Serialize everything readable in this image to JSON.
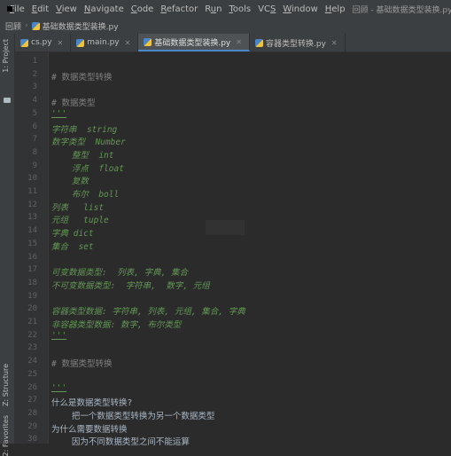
{
  "menubar": {
    "items": [
      {
        "label": "File",
        "ul": "F"
      },
      {
        "label": "Edit",
        "ul": "E"
      },
      {
        "label": "View",
        "ul": "V"
      },
      {
        "label": "Navigate",
        "ul": "N"
      },
      {
        "label": "Code",
        "ul": "C"
      },
      {
        "label": "Refactor",
        "ul": "R"
      },
      {
        "label": "Run",
        "ul": "u"
      },
      {
        "label": "Tools",
        "ul": "T"
      },
      {
        "label": "VCS",
        "ul": "S"
      },
      {
        "label": "Window",
        "ul": "W"
      },
      {
        "label": "Help",
        "ul": "H"
      }
    ],
    "window_title": "回顾 - 基础数据类型装换.py"
  },
  "navbar": {
    "project": "回顾",
    "file": "基础数据类型装换.py"
  },
  "sidebar": {
    "project_label": "1: Project",
    "structure_label": "Z: Structure",
    "favorites_label": "2: Favorites"
  },
  "tabs": [
    {
      "label": "cs.py",
      "active": false
    },
    {
      "label": "main.py",
      "active": false
    },
    {
      "label": "基础数据类型装换.py",
      "active": true
    },
    {
      "label": "容器类型转换.py",
      "active": false
    }
  ],
  "code_lines": [
    {
      "n": "1",
      "text": "",
      "style": "plain"
    },
    {
      "n": "2",
      "text": "# 数据类型转换",
      "style": "comment"
    },
    {
      "n": "3",
      "text": "",
      "style": "plain"
    },
    {
      "n": "4",
      "text": "# 数据类型",
      "style": "comment"
    },
    {
      "n": "5",
      "text": "'''",
      "style": "quote"
    },
    {
      "n": "6",
      "text": "字符串  string",
      "style": "doc"
    },
    {
      "n": "7",
      "text": "数字类型  Number",
      "style": "doc"
    },
    {
      "n": "8",
      "text": "    整型  int",
      "style": "doc"
    },
    {
      "n": "9",
      "text": "    浮点  float",
      "style": "doc"
    },
    {
      "n": "10",
      "text": "    复数",
      "style": "doc"
    },
    {
      "n": "11",
      "text": "    布尔  boll",
      "style": "doc"
    },
    {
      "n": "12",
      "text": "列表   list",
      "style": "doc"
    },
    {
      "n": "13",
      "text": "元组   tuple",
      "style": "doc"
    },
    {
      "n": "14",
      "text": "字典 dict",
      "style": "doc"
    },
    {
      "n": "15",
      "text": "集合  set",
      "style": "doc"
    },
    {
      "n": "16",
      "text": "",
      "style": "plain"
    },
    {
      "n": "17",
      "text": "可变数据类型:  列表, 字典, 集合",
      "style": "doc"
    },
    {
      "n": "18",
      "text": "不可变数据类型:  字符串,  数字, 元组",
      "style": "doc"
    },
    {
      "n": "19",
      "text": "",
      "style": "plain"
    },
    {
      "n": "20",
      "text": "容器类型数据: 字符串, 列表, 元组, 集合, 字典",
      "style": "doc"
    },
    {
      "n": "21",
      "text": "非容器类型数据: 数字, 布尔类型",
      "style": "doc"
    },
    {
      "n": "22",
      "text": "'''",
      "style": "quote"
    },
    {
      "n": "23",
      "text": "",
      "style": "plain"
    },
    {
      "n": "24",
      "text": "# 数据类型转换",
      "style": "comment"
    },
    {
      "n": "25",
      "text": "",
      "style": "plain"
    },
    {
      "n": "26",
      "text": "'''",
      "style": "quote"
    },
    {
      "n": "27",
      "text": "什么是数据类型转换?",
      "style": "plain"
    },
    {
      "n": "28",
      "text": "    把一个数据类型转换为另一个数据类型",
      "style": "plain"
    },
    {
      "n": "29",
      "text": "为什么需要数据转换",
      "style": "plain"
    },
    {
      "n": "30",
      "text": "    因为不同数据类型之间不能运算",
      "style": "plain"
    }
  ]
}
